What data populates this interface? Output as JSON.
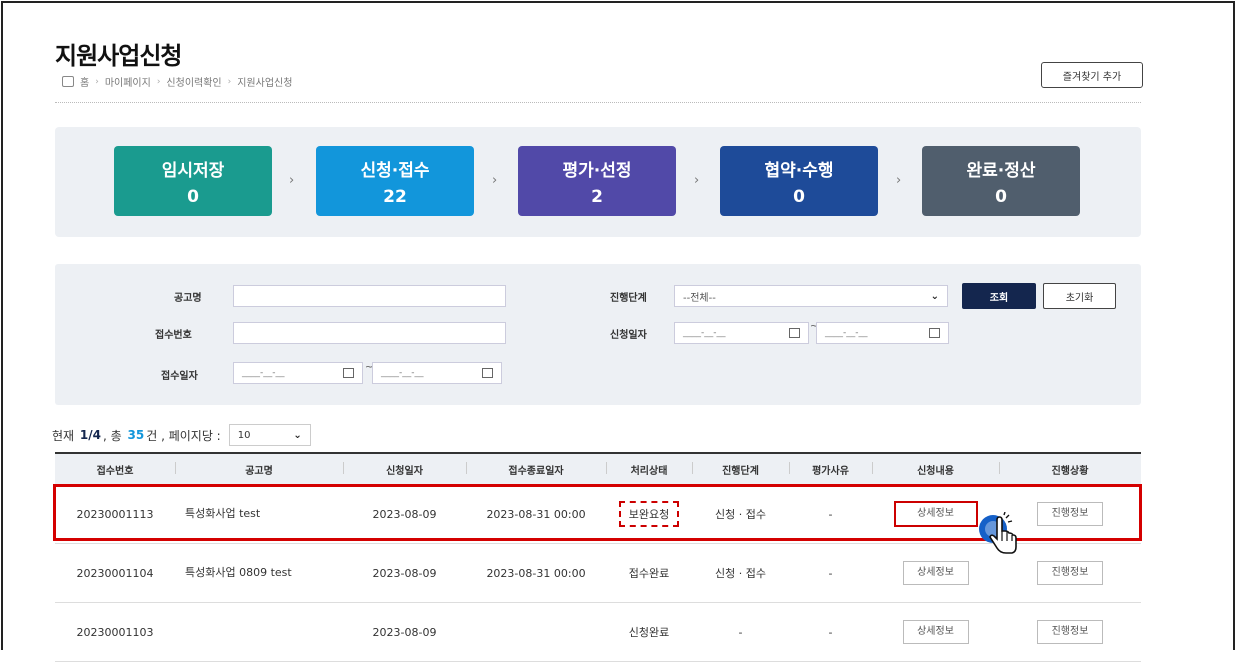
{
  "page": {
    "title": "지원사업신청",
    "breadcrumb": [
      "홈",
      "마이페이지",
      "신청이력확인",
      "지원사업신청"
    ],
    "favorite_button": "즐겨찾기 추가"
  },
  "steps": [
    {
      "label": "임시저장",
      "count": "0",
      "color": "#1a9b8f"
    },
    {
      "label": "신청·접수",
      "count": "22",
      "color": "#1296db"
    },
    {
      "label": "평가·선정",
      "count": "2",
      "color": "#5149a8"
    },
    {
      "label": "협약·수행",
      "count": "0",
      "color": "#1e4b99"
    },
    {
      "label": "완료·정산",
      "count": "0",
      "color": "#505e6d"
    }
  ],
  "search": {
    "notice_label": "공고명",
    "receipt_no_label": "접수번호",
    "receipt_date_label": "접수일자",
    "stage_label": "진행단계",
    "stage_value": "--전체--",
    "apply_date_label": "신청일자",
    "date_placeholder": "____-__-__",
    "search_button": "조회",
    "reset_button": "초기화"
  },
  "paging": {
    "prefix": "현재",
    "current": "1/4",
    "mid": ", 총",
    "total": "35",
    "suffix": "건 , 페이지당 :",
    "per_page": "10"
  },
  "table": {
    "headers": [
      "접수번호",
      "공고명",
      "신청일자",
      "접수종료일자",
      "처리상태",
      "진행단계",
      "평가사유",
      "신청내용",
      "진행상황"
    ],
    "rows": [
      {
        "no": "20230001113",
        "name": "특성화사업 test",
        "date": "2023-08-09",
        "end": "2023-08-31 00:00",
        "status": "보완요청",
        "stage": "신청 · 접수",
        "reason": "-",
        "detail": "상세정보",
        "progress": "진행정보"
      },
      {
        "no": "20230001104",
        "name": "특성화사업 0809 test",
        "date": "2023-08-09",
        "end": "2023-08-31 00:00",
        "status": "접수완료",
        "stage": "신청 · 접수",
        "reason": "-",
        "detail": "상세정보",
        "progress": "진행정보"
      },
      {
        "no": "20230001103",
        "name": "",
        "date": "2023-08-09",
        "end": "",
        "status": "신청완료",
        "stage": "-",
        "reason": "-",
        "detail": "상세정보",
        "progress": "진행정보"
      }
    ]
  },
  "colors": {
    "highlight": "#d40000",
    "navy": "#14264e"
  }
}
